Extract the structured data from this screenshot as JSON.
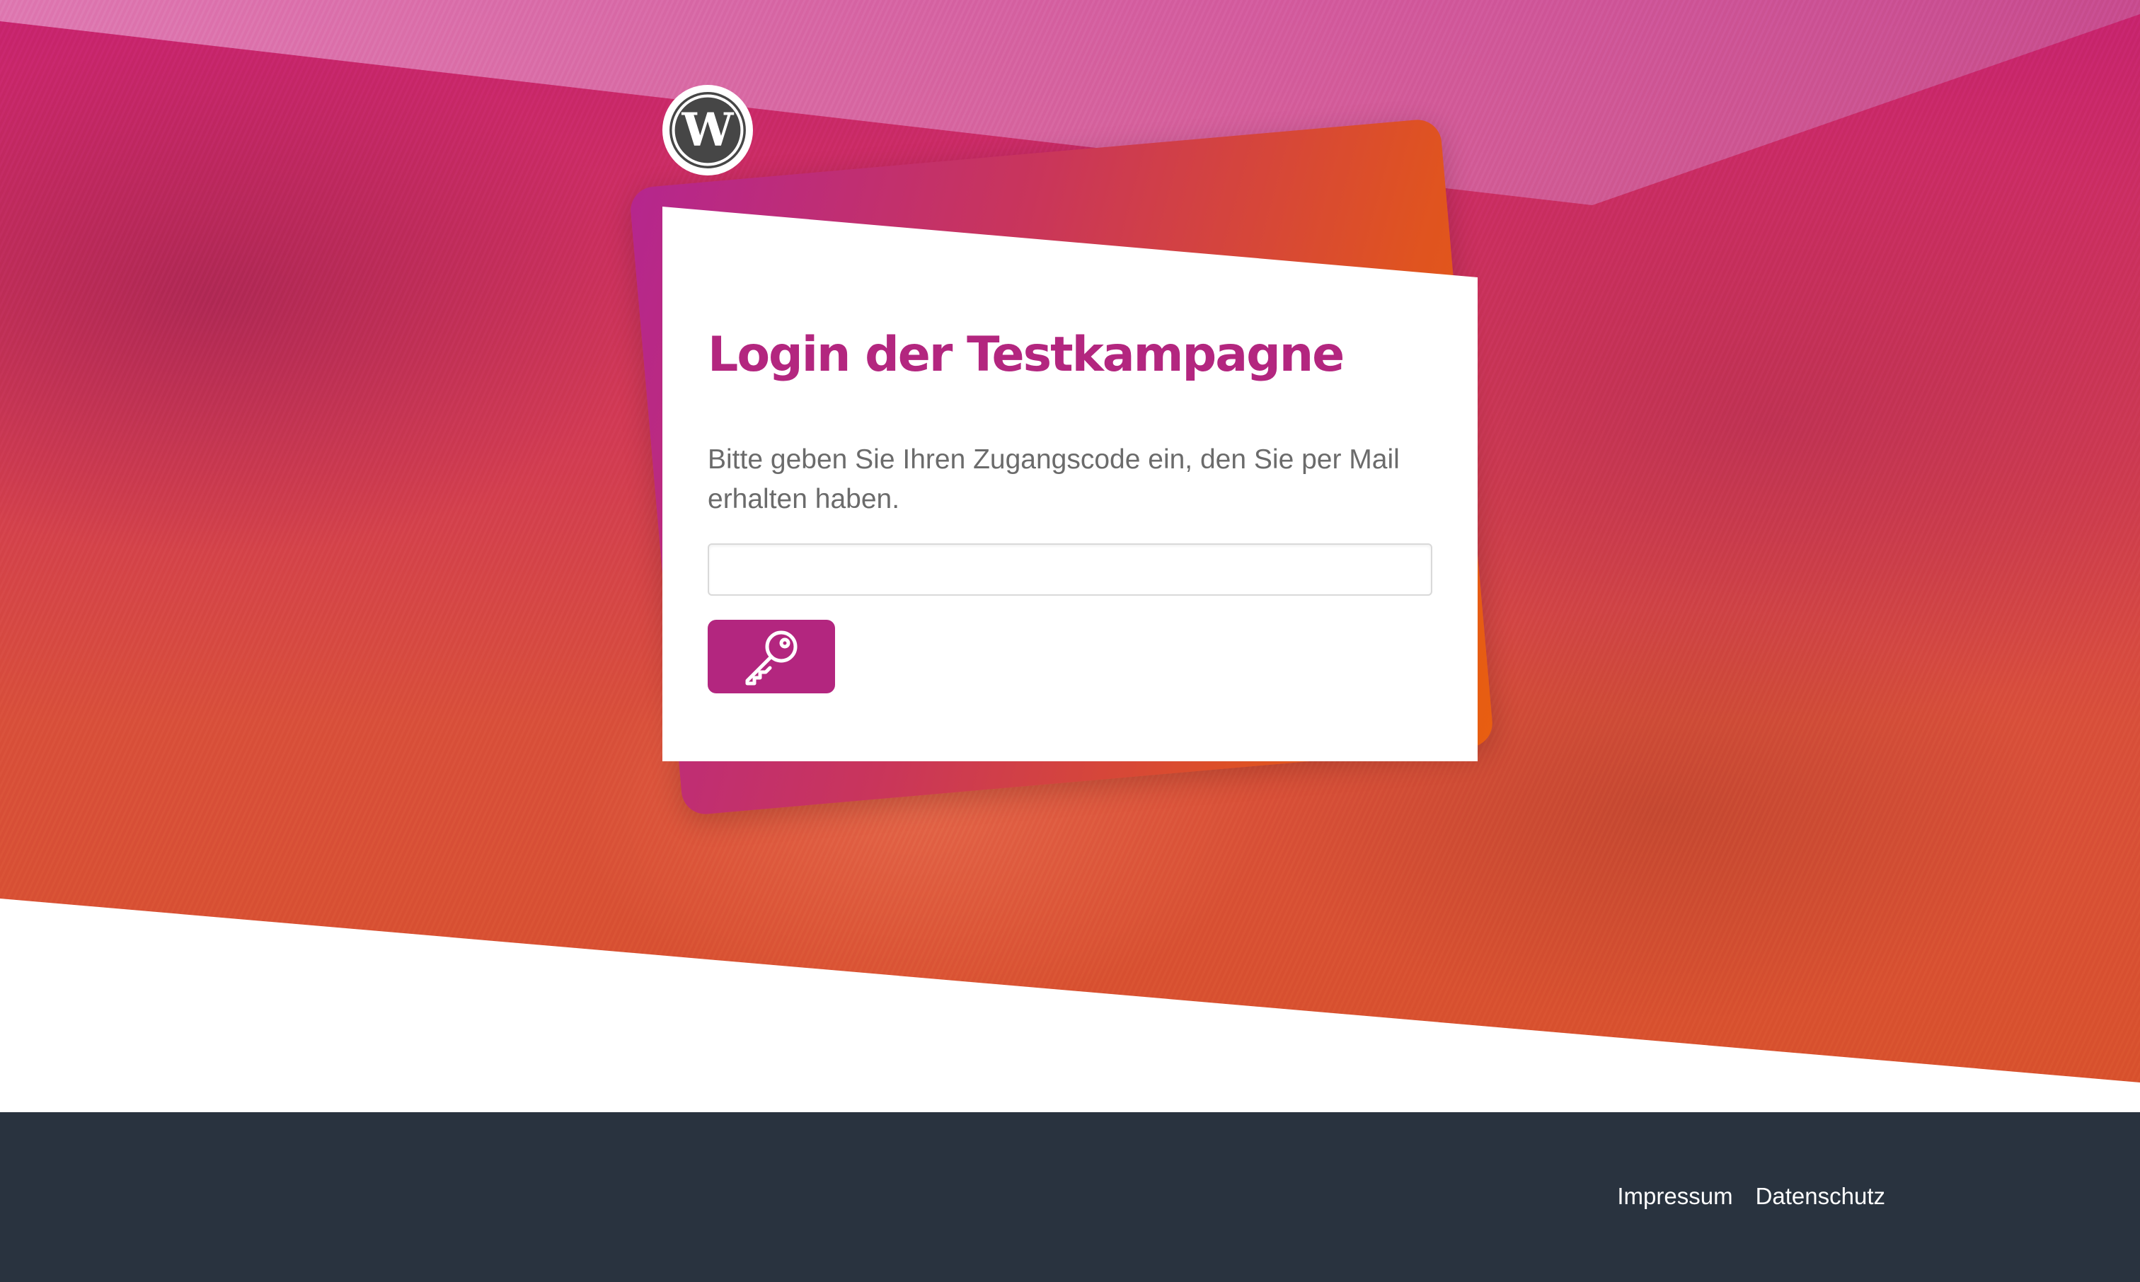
{
  "login": {
    "title": "Login der Testkampagne",
    "description": "Bitte geben Sie Ihren Zugangscode ein, den Sie per Mail erhalten haben.",
    "code_value": "",
    "submit_icon": "key-icon"
  },
  "logo": {
    "icon": "wordpress-logo"
  },
  "footer": {
    "links": [
      {
        "label": "Impressum"
      },
      {
        "label": "Datenschutz"
      }
    ]
  },
  "colors": {
    "accent": "#b3267f",
    "gradient_orange": "#e85e10",
    "footer_bg": "#29333f"
  }
}
